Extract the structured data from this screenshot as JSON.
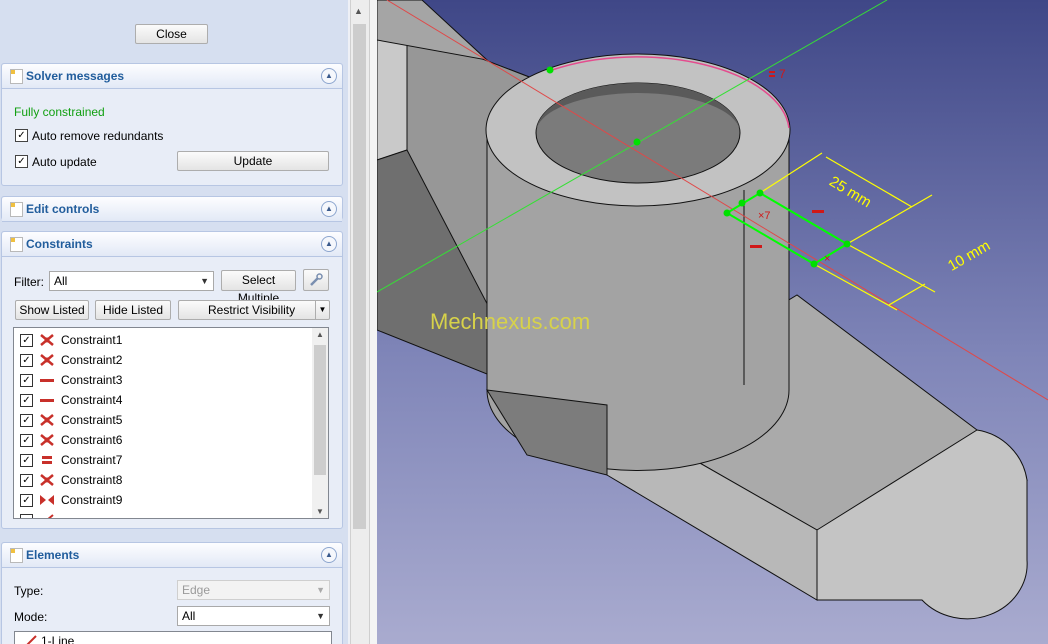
{
  "task_panel": {
    "close_label": "Close",
    "solver_messages": {
      "title": "Solver messages",
      "status": "Fully constrained",
      "auto_remove_redundants": "Auto remove redundants",
      "auto_update": "Auto update",
      "update_label": "Update"
    },
    "edit_controls": {
      "title": "Edit controls"
    },
    "constraints": {
      "title": "Constraints",
      "filter_label": "Filter:",
      "filter_value": "All",
      "select_multiple_label": "Select Multiple",
      "show_listed_label": "Show Listed",
      "hide_listed_label": "Hide Listed",
      "restrict_visibility_label": "Restrict Visibility",
      "items": [
        {
          "label": "Constraint1",
          "icon": "coincident-icon"
        },
        {
          "label": "Constraint2",
          "icon": "coincident-icon"
        },
        {
          "label": "Constraint3",
          "icon": "horizontal-icon"
        },
        {
          "label": "Constraint4",
          "icon": "horizontal-icon"
        },
        {
          "label": "Constraint5",
          "icon": "coincident-icon"
        },
        {
          "label": "Constraint6",
          "icon": "coincident-icon"
        },
        {
          "label": "Constraint7",
          "icon": "equal-icon"
        },
        {
          "label": "Constraint8",
          "icon": "coincident-icon"
        },
        {
          "label": "Constraint9",
          "icon": "symmetric-icon"
        }
      ]
    },
    "elements": {
      "title": "Elements",
      "type_label": "Type:",
      "type_value": "Edge",
      "mode_label": "Mode:",
      "mode_value": "All",
      "first_item": "1-Line"
    }
  },
  "viewport": {
    "watermark": "Mechnexus.com",
    "dimension_1": "25 mm",
    "dimension_2": "10 mm",
    "equal_marker": "7",
    "colors": {
      "construction": "#35e035",
      "sketch_line": "#e04848",
      "dimension": "#ffff00",
      "selected": "#00ff00"
    }
  }
}
